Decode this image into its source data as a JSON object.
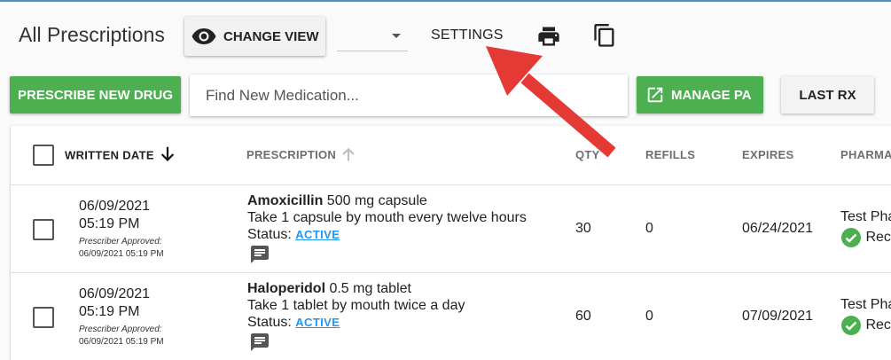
{
  "header": {
    "title": "All Prescriptions",
    "change_view_label": "CHANGE VIEW",
    "view_select_value": "",
    "settings_label": "SETTINGS",
    "print_icon": "print-icon",
    "copy_icon": "copy-icon"
  },
  "toolbar": {
    "prescribe_label": "PRESCRIBE NEW DRUG",
    "search_placeholder": "Find New Medication...",
    "search_value": "",
    "manage_pa_label": "MANAGE PA",
    "last_rx_label": "LAST RX"
  },
  "table": {
    "columns": {
      "written_date": "WRITTEN DATE",
      "prescription": "PRESCRIPTION",
      "qty": "QTY",
      "refills": "REFILLS",
      "expires": "EXPIRES",
      "pharmacy": "PHARMA"
    },
    "rows": [
      {
        "date": "06/09/2021",
        "time": "05:19 PM",
        "approved_label": "Prescriber Approved:",
        "approved_ts": "06/09/2021 05:19 PM",
        "drug": "Amoxicillin",
        "strength": " 500 mg capsule",
        "sig": "Take 1 capsule by mouth every twelve hours",
        "status_label": "Status: ",
        "status": "ACTIVE",
        "qty": "30",
        "refills": "0",
        "expires": "06/24/2021",
        "pharmacy": "Test Pha",
        "pharmacy_status": "Rec"
      },
      {
        "date": "06/09/2021",
        "time": "05:19 PM",
        "approved_label": "Prescriber Approved:",
        "approved_ts": "06/09/2021 05:19 PM",
        "drug": "Haloperidol",
        "strength": " 0.5 mg tablet",
        "sig": "Take 1 tablet by mouth twice a day",
        "status_label": "Status: ",
        "status": "ACTIVE",
        "qty": "60",
        "refills": "0",
        "expires": "07/09/2021",
        "pharmacy": "Test Pha",
        "pharmacy_status": "Rec"
      }
    ]
  },
  "colors": {
    "green": "#4caf50",
    "link_blue": "#2196f3",
    "annotation_red": "#e53935"
  }
}
